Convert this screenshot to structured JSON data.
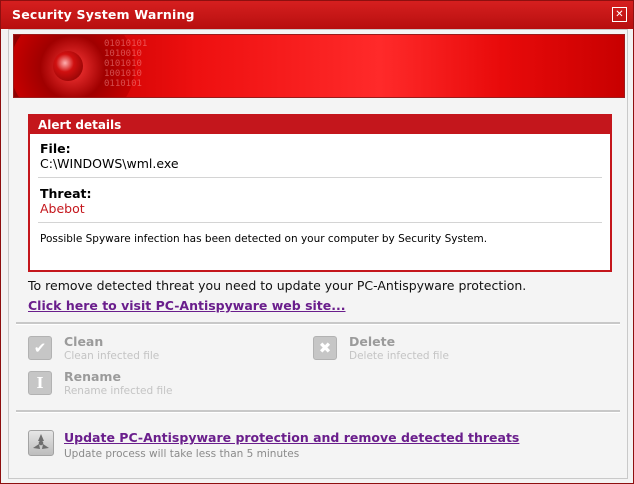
{
  "window": {
    "title": "Security System Warning",
    "close_icon": "close-icon"
  },
  "banner": {
    "digits": "01010101\n1010010\n0101010\n1001010\n0110101"
  },
  "alert": {
    "header": "Alert details",
    "file_label": "File:",
    "file_value": "C:\\WINDOWS\\wml.exe",
    "threat_label": "Threat:",
    "threat_value": "Abebot",
    "note": "Possible Spyware infection has been detected on your computer by Security System."
  },
  "instruction": "To remove detected threat you need to update your PC-Antispyware protection.",
  "visit_link": "Click here to visit PC-Antispyware web site...",
  "actions": [
    {
      "name": "Clean",
      "desc": "Clean infected file",
      "icon": "check-icon"
    },
    {
      "name": "Delete",
      "desc": "Delete infected file",
      "icon": "x-icon"
    },
    {
      "name": "Rename",
      "desc": "Rename infected file",
      "icon": "rename-icon"
    }
  ],
  "update": {
    "label": "Update PC-Antispyware protection and remove detected threats",
    "desc": "Update process will take less than 5 minutes",
    "icon": "radiation-icon"
  },
  "colors": {
    "title_red": "#c4161c",
    "link_purple": "#6a1e8c",
    "threat_red": "#c4161c"
  }
}
